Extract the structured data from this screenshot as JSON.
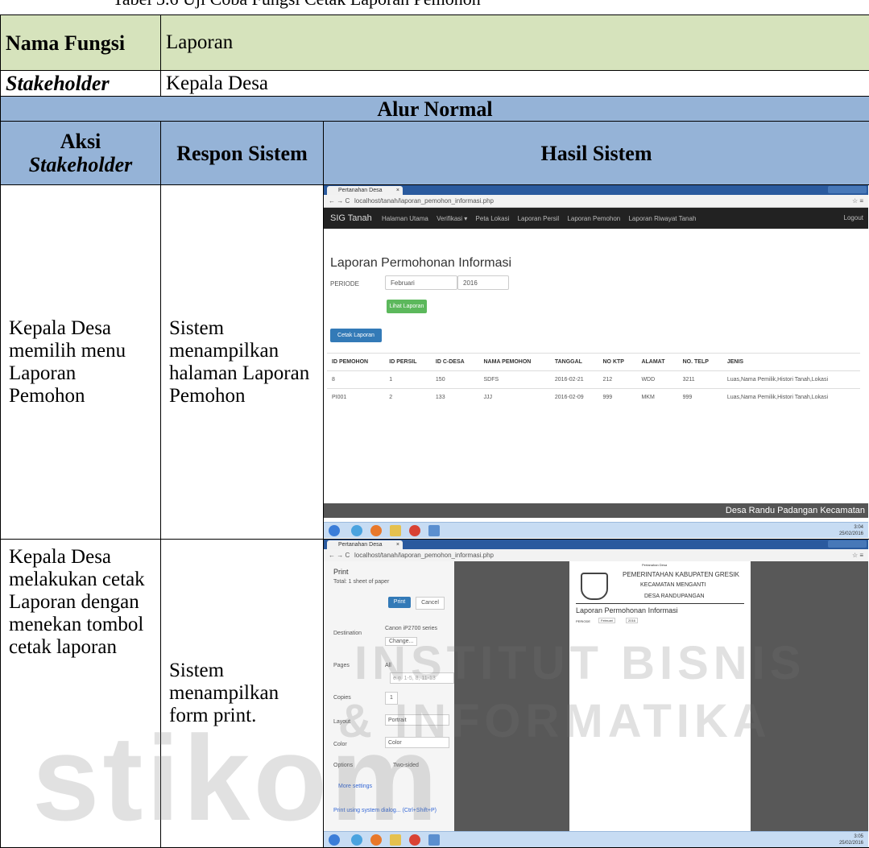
{
  "top_caption": "Tabel 3.6 Uji Coba Fungsi Cetak Laporan Pemohon",
  "rows": {
    "nama_fungsi_label": "Nama Fungsi",
    "nama_fungsi_value": "Laporan",
    "stakeholder_label": "Stakeholder",
    "stakeholder_value": "Kepala Desa",
    "alur_normal": "Alur Normal",
    "col_aksi_1": "Aksi",
    "col_aksi_2": "Stakeholder",
    "col_respon": "Respon Sistem",
    "col_hasil": "Hasil Sistem"
  },
  "step1": {
    "aksi": "Kepala Desa memilih menu Laporan Pemohon",
    "respon": "Sistem menampilkan halaman Laporan Pemohon"
  },
  "step2": {
    "aksi": "Kepala Desa melakukan cetak Laporan dengan menekan tombol cetak laporan",
    "respon": "Sistem menampilkan form print."
  },
  "shot1": {
    "tab_title": "Pertanahan Desa",
    "url": "localhost/tanah/laporan_pemohon_informasi.php",
    "brand": "SIG Tanah",
    "nav": [
      "Halaman Utama",
      "Verifikasi ▾",
      "Peta Lokasi",
      "Laporan Persil",
      "Laporan Pemohon",
      "Laporan Riwayat Tanah"
    ],
    "logout": "Logout",
    "page_title": "Laporan Permohonan Informasi",
    "periode_label": "PERIODE",
    "month": "Februari",
    "year": "2016",
    "btn_lihat": "Lihat Laporan",
    "btn_cetak": "Cetak Laporan",
    "table_headers": [
      "ID PEMOHON",
      "ID PERSIL",
      "ID C-DESA",
      "NAMA PEMOHON",
      "TANGGAL",
      "NO KTP",
      "ALAMAT",
      "NO. TELP",
      "JENIS"
    ],
    "table_rows": [
      [
        "8",
        "1",
        "150",
        "SDFS",
        "2016-02-21",
        "212",
        "WDD",
        "3211",
        "Luas,Nama Pemilik,Histori Tanah,Lokasi"
      ],
      [
        "PI001",
        "2",
        "133",
        "JJJ",
        "2016-02-09",
        "999",
        "MKM",
        "999",
        "Luas,Nama Pemilik,Histori Tanah,Lokasi"
      ]
    ],
    "footer": "Desa Randu Padangan Kecamatan",
    "clock_time": "3:04",
    "clock_date": "25/02/2016"
  },
  "shot2": {
    "tab_title": "Pertanahan Desa",
    "url": "localhost/tanah/laporan_pemohon_informasi.php",
    "print_title": "Print",
    "total": "Total: 1 sheet of paper",
    "btn_print": "Print",
    "btn_cancel": "Cancel",
    "destination_label": "Destination",
    "destination_value": "Canon iP2700 series",
    "change": "Change...",
    "pages_label": "Pages",
    "pages_all": "All",
    "pages_hint": "e.g. 1-5, 8, 11-13",
    "copies_label": "Copies",
    "copies_value": "1",
    "layout_label": "Layout",
    "layout_value": "Portrait",
    "color_label": "Color",
    "color_value": "Color",
    "options_label": "Options",
    "two_sided": "Two-sided",
    "more_settings": "More settings",
    "system_dialog": "Print using system dialog... (Ctrl+Shift+P)",
    "doc_head_small": "Pertanahan Desa",
    "doc_gov": "PEMERINTAHAN KABUPATEN GRESIK",
    "doc_kec": "KECAMATAN MENGANTI",
    "doc_desa": "DESA RANDUPANGAN",
    "doc_title": "Laporan Permohonan Informasi",
    "doc_periode": "PERIODE",
    "doc_month": "Februari",
    "doc_year": "2016",
    "clock_time": "3:05",
    "clock_date": "25/02/2016"
  },
  "watermark": {
    "line1": "INSTITUT BISNIS",
    "line2": "& INFORMATIKA",
    "line3": "stikom"
  }
}
